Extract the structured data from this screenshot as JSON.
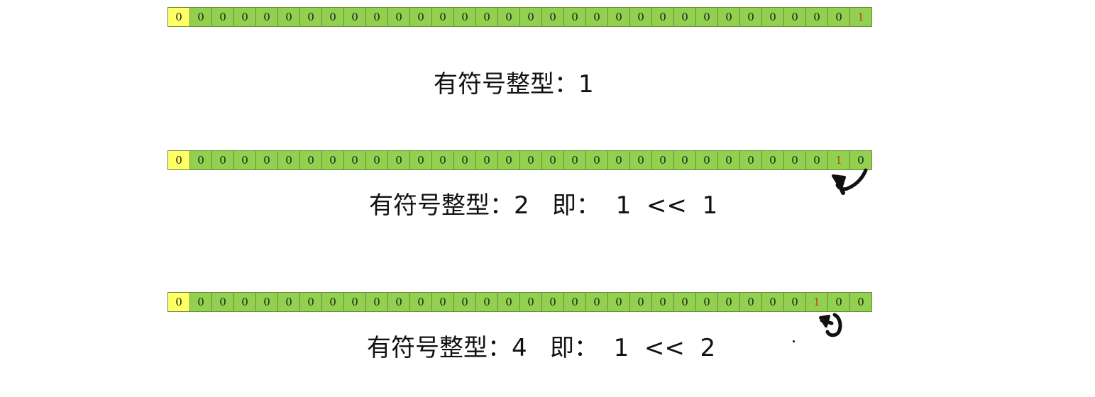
{
  "colors": {
    "sign_bit": "#ffff66",
    "value_bit": "#92d050",
    "highlight_text": "#c0392b"
  },
  "rows": [
    {
      "bits": [
        "0",
        "0",
        "0",
        "0",
        "0",
        "0",
        "0",
        "0",
        "0",
        "0",
        "0",
        "0",
        "0",
        "0",
        "0",
        "0",
        "0",
        "0",
        "0",
        "0",
        "0",
        "0",
        "0",
        "0",
        "0",
        "0",
        "0",
        "0",
        "0",
        "0",
        "0",
        "1"
      ],
      "highlight_index": 31,
      "caption": "有符号整型：1"
    },
    {
      "bits": [
        "0",
        "0",
        "0",
        "0",
        "0",
        "0",
        "0",
        "0",
        "0",
        "0",
        "0",
        "0",
        "0",
        "0",
        "0",
        "0",
        "0",
        "0",
        "0",
        "0",
        "0",
        "0",
        "0",
        "0",
        "0",
        "0",
        "0",
        "0",
        "0",
        "0",
        "1",
        "0"
      ],
      "highlight_index": 30,
      "caption": "有符号整型：2   即：  1  <<  1"
    },
    {
      "bits": [
        "0",
        "0",
        "0",
        "0",
        "0",
        "0",
        "0",
        "0",
        "0",
        "0",
        "0",
        "0",
        "0",
        "0",
        "0",
        "0",
        "0",
        "0",
        "0",
        "0",
        "0",
        "0",
        "0",
        "0",
        "0",
        "0",
        "0",
        "0",
        "0",
        "1",
        "0",
        "0"
      ],
      "highlight_index": 29,
      "caption": "有符号整型：4   即：  1  <<  2"
    }
  ],
  "annotations": [
    "shift-arrow-icon",
    "shift-arrow-icon"
  ]
}
